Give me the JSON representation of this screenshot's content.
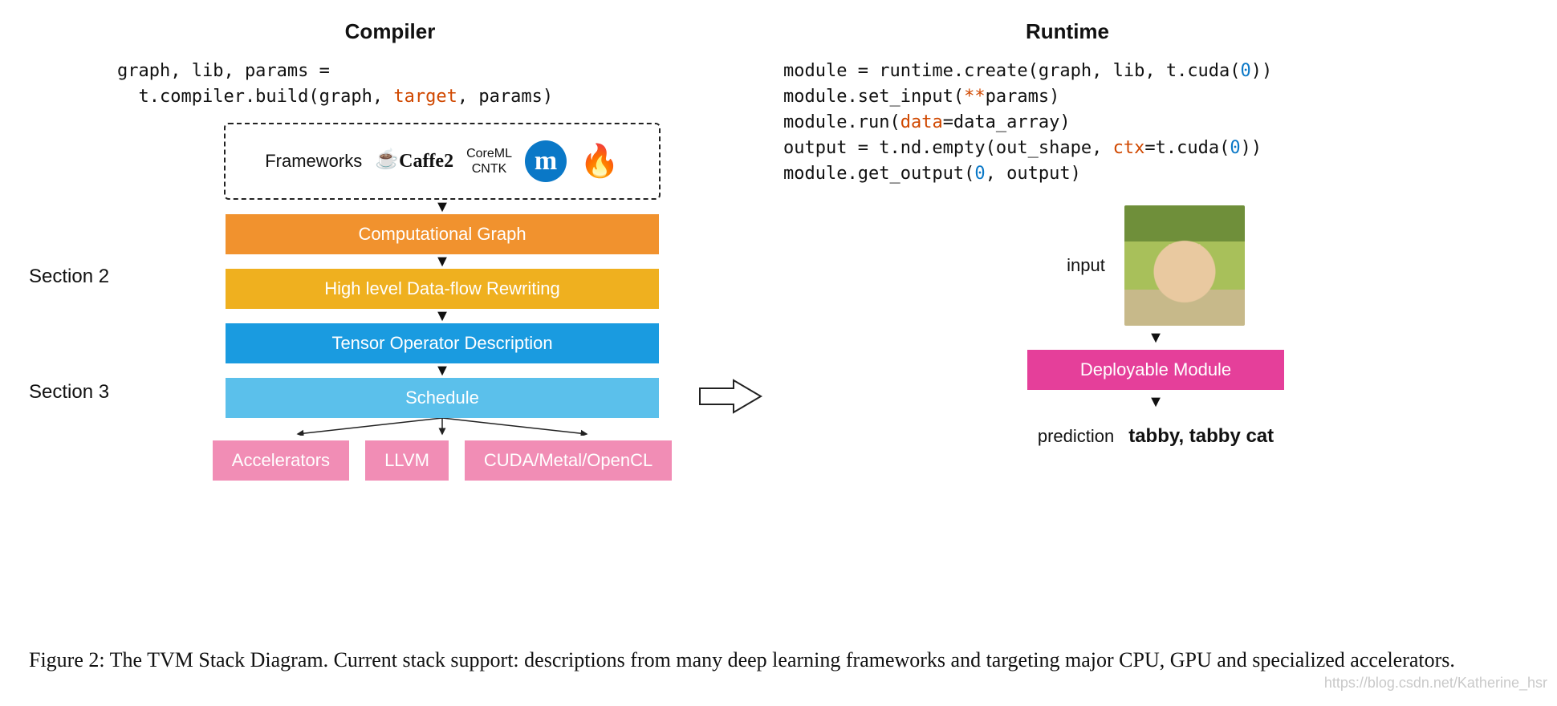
{
  "compiler": {
    "title": "Compiler",
    "code_line1": "graph, lib, params =",
    "code_line2_a": "  t.compiler.build(graph, ",
    "code_line2_kw": "target",
    "code_line2_b": ", params)",
    "frameworks_label": "Frameworks",
    "fw_caffe2": "Caffe2",
    "fw_coreml": "CoreML",
    "fw_cntk": "CNTK",
    "section2": "Section 2",
    "section3": "Section 3",
    "layer1": "Computational Graph",
    "layer2": "High level Data-flow Rewriting",
    "layer3": "Tensor Operator Description",
    "layer4": "Schedule",
    "target_accel": "Accelerators",
    "target_llvm": "LLVM",
    "target_gpu": "CUDA/Metal/OpenCL"
  },
  "runtime": {
    "title": "Runtime",
    "l1a": "module = runtime.create(graph, lib, t.cuda(",
    "l1n": "0",
    "l1b": "))",
    "l2a": "module.set_input(",
    "l2kw": "**",
    "l2b": "params)",
    "l3a": "module.run(",
    "l3kw": "data",
    "l3b": "=data_array)",
    "l4a": "output = t.nd.empty(out_shape, ",
    "l4kw": "ctx",
    "l4b": "=t.cuda(",
    "l4n": "0",
    "l4c": "))",
    "l5a": "module.get_output(",
    "l5n": "0",
    "l5b": ", output)",
    "input_label": "input",
    "module_label": "Deployable Module",
    "pred_label": "prediction",
    "pred_value": "tabby, tabby cat"
  },
  "caption": "Figure 2: The TVM Stack Diagram. Current stack support: descriptions from many deep learning frameworks and targeting major CPU, GPU and specialized accelerators.",
  "watermark": "https://blog.csdn.net/Katherine_hsr"
}
